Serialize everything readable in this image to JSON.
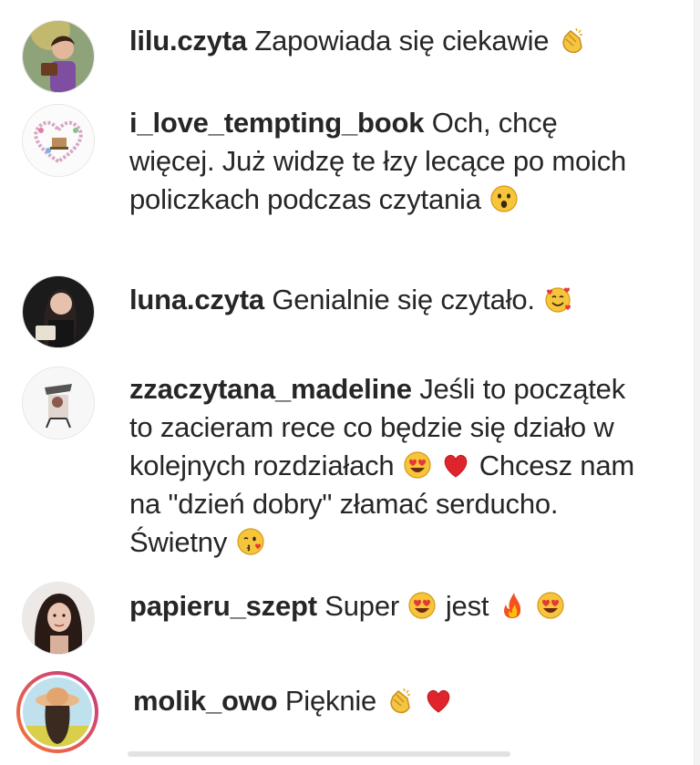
{
  "comments": [
    {
      "username": "lilu.czyta",
      "parts": [
        "Zapowiada się ciekawie"
      ],
      "emoji": [
        "clapping-hands"
      ]
    },
    {
      "username": "i_love_tempting_book",
      "text": "Och, chcę więcej. Już widzę te łzy lecące po moich policzkach podczas czytania",
      "emoji": [
        "astonished-face"
      ]
    },
    {
      "username": "luna.czyta",
      "parts": [
        "Genialnie się czytało."
      ],
      "emoji": [
        "smiling-face-with-hearts"
      ]
    },
    {
      "username": "zzaczytana_madeline",
      "parts": [
        "Jeśli to początek to zacieram rece co będzie się działo w kolejnych rozdziałach",
        "Chcesz nam na \"dzień dobry\" złamać serducho. Świetny"
      ],
      "emoji": [
        "heart-eyes-face",
        "red-heart",
        "face-blowing-kiss"
      ]
    },
    {
      "username": "papieru_szept",
      "parts": [
        "Super",
        "jest"
      ],
      "emoji": [
        "heart-eyes-face",
        "fire",
        "heart-eyes-face"
      ]
    },
    {
      "username": "molik_owo",
      "parts": [
        "Pięknie"
      ],
      "emoji": [
        "clapping-hands",
        "red-heart"
      ]
    }
  ],
  "colors": {
    "text": "#262626",
    "background": "#ffffff",
    "story_ring_start": "#f77737",
    "story_ring_end": "#c13584"
  }
}
